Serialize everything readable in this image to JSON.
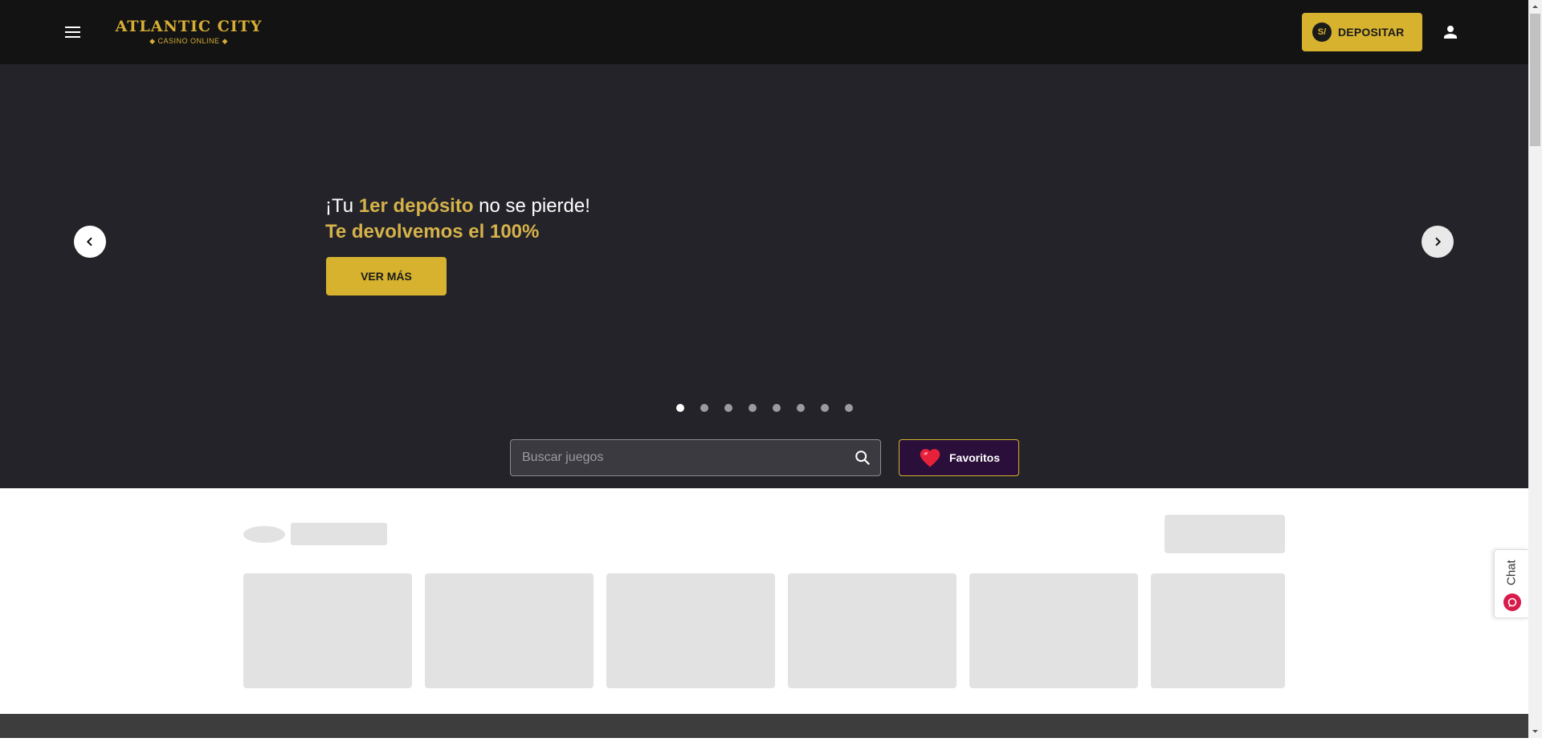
{
  "header": {
    "logo_main": "ATLANTIC CITY",
    "logo_sub": "◆ CASINO ONLINE ◆",
    "deposit_currency": "S/",
    "deposit_label": "DEPOSITAR"
  },
  "hero": {
    "line1_prefix": "¡Tu ",
    "line1_highlight": "1er depósito",
    "line1_suffix": " no se pierde!",
    "line2": "Te devolvemos el 100%",
    "cta_label": "VER MÁS",
    "slide_count": 8,
    "active_slide": 1
  },
  "search": {
    "placeholder": "Buscar juegos",
    "value": ""
  },
  "favorites": {
    "label": "Favoritos"
  },
  "chat": {
    "label": "Chat"
  },
  "colors": {
    "accent_gold": "#d6b22f",
    "header_bg": "#131313",
    "hero_bg": "#232329",
    "favorites_bg": "#2a0f3a",
    "skeleton": "#e2e2e2",
    "chat_icon": "#d71b4b"
  },
  "icons": {
    "menu": "hamburger-menu-icon",
    "user": "user-icon",
    "prev": "chevron-left-icon",
    "next": "chevron-right-icon",
    "search": "search-icon",
    "favorites": "heart-icon",
    "chat": "chat-bubble-icon"
  }
}
